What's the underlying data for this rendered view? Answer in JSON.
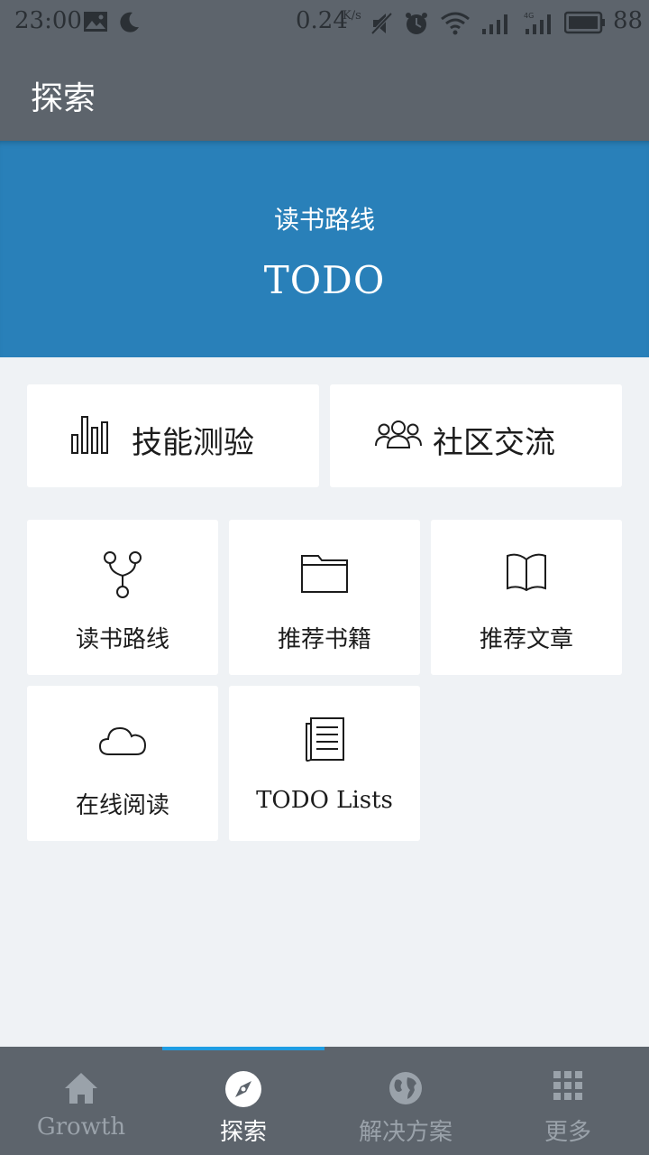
{
  "status_bar": {
    "time": "23:00",
    "net_speed": "0.24",
    "net_speed_unit": "K/s",
    "battery_level": "88",
    "icons": [
      "image-icon",
      "moon-icon",
      "mute-icon",
      "alarm-icon",
      "wifi-icon",
      "signal-icon",
      "4g-signal-icon",
      "battery-icon"
    ]
  },
  "app_bar": {
    "title": "探索"
  },
  "banner": {
    "subtitle": "读书路线",
    "title": "TODO"
  },
  "wide_cards": [
    {
      "label": "技能测验",
      "icon": "bar-chart-icon"
    },
    {
      "label": "社区交流",
      "icon": "users-icon"
    }
  ],
  "tiles": [
    {
      "label": "读书路线",
      "icon": "branch-icon"
    },
    {
      "label": "推荐书籍",
      "icon": "folder-icon"
    },
    {
      "label": "推荐文章",
      "icon": "open-book-icon"
    },
    {
      "label": "在线阅读",
      "icon": "cloud-icon"
    },
    {
      "label": "TODO Lists",
      "icon": "document-list-icon"
    }
  ],
  "tab_bar": {
    "active_index": 1,
    "tabs": [
      {
        "label": "Growth",
        "icon": "home-icon"
      },
      {
        "label": "探索",
        "icon": "compass-icon"
      },
      {
        "label": "解决方案",
        "icon": "globe-icon"
      },
      {
        "label": "更多",
        "icon": "grid-icon"
      }
    ]
  },
  "colors": {
    "bar_background": "#5d646c",
    "banner_background": "#2980b9",
    "page_background": "#eff2f5",
    "tab_indicator": "#1e9de3",
    "inactive_tab": "#9aa2aa"
  }
}
